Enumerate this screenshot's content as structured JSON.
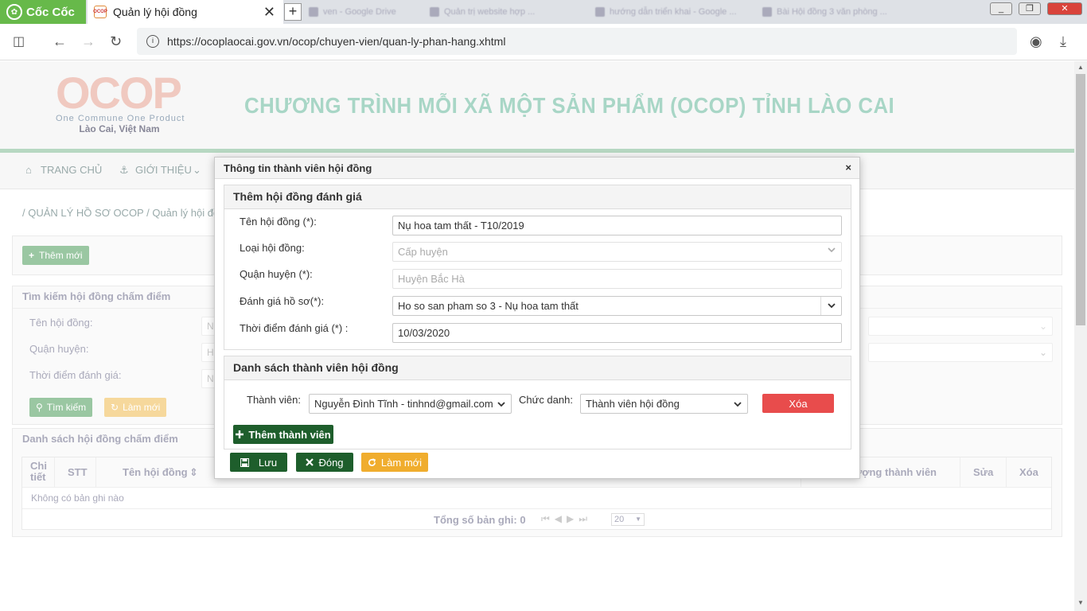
{
  "browser": {
    "brand": "Cốc Cốc",
    "active_tab": {
      "title": "Quản lý hội đồng",
      "favicon": "OCOP"
    },
    "new_tab_label": "+",
    "bg_tabs": [
      "ven - Google Drive",
      "Quản trị website hợp ...",
      "hướng dẫn triển khai - Google ...",
      "Bài Hội đồng 3 văn phòng ..."
    ],
    "url": "https://ocoplaocai.gov.vn/ocop/chuyen-vien/quan-ly-phan-hang.xhtml"
  },
  "site": {
    "logo_text": "OCOP",
    "logo_sub": "One Commune One Product",
    "logo_loc": "Lào Cai, Việt Nam",
    "program_title": "CHƯƠNG TRÌNH MỖI XÃ MỘT SẢN PHẨM (OCOP) TỈNH LÀO CAI",
    "menu": {
      "home": "TRANG CHỦ",
      "about": "GIỚI THIỆU"
    },
    "breadcrumb": "/ QUẢN LÝ HỒ SƠ OCOP / Quản lý hội đồ",
    "add_new": "Thêm mới",
    "search_panel": {
      "title": "Tìm kiếm hội đồng chấm điểm",
      "name_label": "Tên hội đồng:",
      "district_label": "Quận huyện:",
      "time_label": "Thời điểm đánh giá:",
      "search_btn": "Tìm kiếm",
      "reset_btn": "Làm mới",
      "name_ph": "Nh",
      "district_ph": "H",
      "time_ph": "Ng"
    },
    "list_panel": {
      "title": "Danh sách hội đồng chấm điểm",
      "col_detail": "Chi tiết",
      "col_stt": "STT",
      "col_name": "Tên hội đồng",
      "col_members": "Số lượng thành viên",
      "col_edit": "Sửa",
      "col_delete": "Xóa",
      "empty": "Không có bản ghi nào",
      "total": "Tổng số bản ghi: 0",
      "page_size": "20"
    }
  },
  "dialog": {
    "title": "Thông tin thành viên hội đồng",
    "close": "×",
    "section1": {
      "legend": "Thêm hội đồng đánh giá",
      "name_label": "Tên hội đồng (*):",
      "name_value": "Nụ hoa tam thất - T10/2019",
      "type_label": "Loại hội đồng:",
      "type_value": "Cấp huyện",
      "district_label": "Quận huyện (*):",
      "district_value": "Huyện Bắc Hà",
      "dossier_label": "Đánh giá hồ sơ(*):",
      "dossier_value": "Ho so san pham so 3 - Nụ hoa tam thất",
      "time_label": "Thời điểm đánh giá (*) :",
      "time_value": "10/03/2020"
    },
    "section2": {
      "legend": "Danh sách thành viên hội đồng",
      "member_label": "Thành viên:",
      "member_value": "Nguyễn Đình Tĩnh - tinhnd@gmail.com",
      "role_label": "Chức danh:",
      "role_value": "Thành viên hội đồng",
      "delete_btn": "Xóa",
      "add_member_btn": "Thêm thành viên"
    },
    "footer": {
      "save": "Lưu",
      "close": "Đóng",
      "reset": "Làm mới"
    }
  },
  "colors": {
    "accent_green": "#1e5e2c",
    "danger": "#e84c4c",
    "warning": "#f0ad2e",
    "browser_green": "#67b94a"
  }
}
